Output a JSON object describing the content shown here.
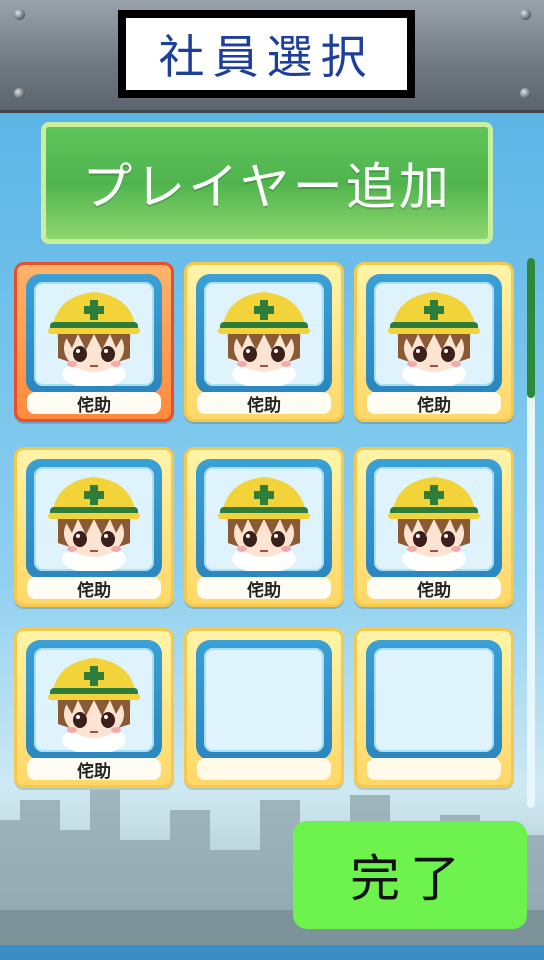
{
  "header": {
    "title": "社員選択"
  },
  "add_button": {
    "label": "プレイヤー追加"
  },
  "slots": [
    {
      "name": "侘助",
      "filled": true,
      "selected": true
    },
    {
      "name": "侘助",
      "filled": true,
      "selected": false
    },
    {
      "name": "侘助",
      "filled": true,
      "selected": false
    },
    {
      "name": "侘助",
      "filled": true,
      "selected": false
    },
    {
      "name": "侘助",
      "filled": true,
      "selected": false
    },
    {
      "name": "侘助",
      "filled": true,
      "selected": false
    },
    {
      "name": "侘助",
      "filled": true,
      "selected": false
    },
    {
      "name": "",
      "filled": false,
      "selected": false
    },
    {
      "name": "",
      "filled": false,
      "selected": false
    }
  ],
  "done_button": {
    "label": "完了"
  },
  "icons": {
    "avatar": "worker-helmet-avatar",
    "rivet": "rivet-icon"
  }
}
